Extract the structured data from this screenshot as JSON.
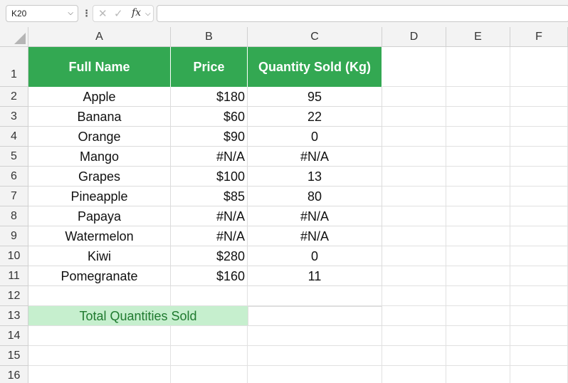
{
  "name_box": "K20",
  "formula_bar": {
    "value": ""
  },
  "columns": [
    "A",
    "B",
    "C",
    "D",
    "E",
    "F"
  ],
  "rows": [
    "1",
    "2",
    "3",
    "4",
    "5",
    "6",
    "7",
    "8",
    "9",
    "10",
    "11",
    "12",
    "13",
    "14",
    "15",
    "16"
  ],
  "table": {
    "headers": [
      "Full Name",
      "Price",
      "Quantity Sold (Kg)"
    ],
    "data": [
      [
        "Apple",
        "$180",
        "95"
      ],
      [
        "Banana",
        "$60",
        "22"
      ],
      [
        "Orange",
        "$90",
        "0"
      ],
      [
        "Mango",
        "#N/A",
        "#N/A"
      ],
      [
        "Grapes",
        "$100",
        "13"
      ],
      [
        "Pineapple",
        "$85",
        "80"
      ],
      [
        "Papaya",
        "#N/A",
        "#N/A"
      ],
      [
        "Watermelon",
        "#N/A",
        "#N/A"
      ],
      [
        "Kiwi",
        "$280",
        "0"
      ],
      [
        "Pomegranate",
        "$160",
        "11"
      ]
    ]
  },
  "total": {
    "label": "Total Quantities Sold",
    "value": ""
  },
  "colors": {
    "header_bg": "#33a852",
    "total_label_bg": "#c6efce",
    "total_label_text": "#1f7a2f"
  }
}
